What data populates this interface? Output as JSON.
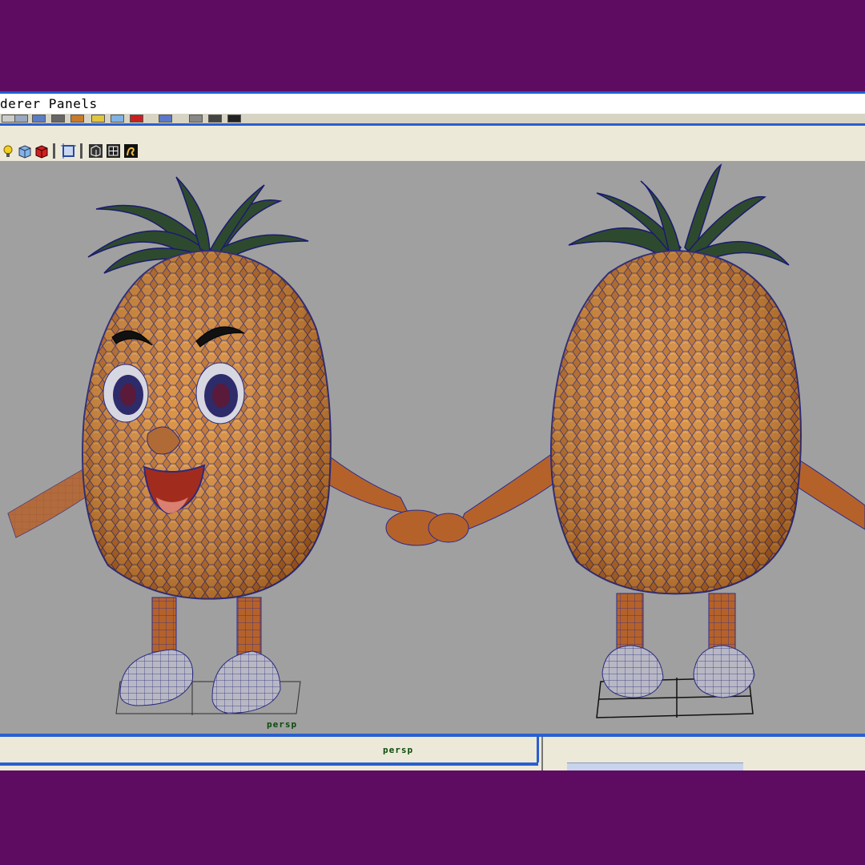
{
  "menu": {
    "visible_text": "derer Panels"
  },
  "viewport": {
    "label_left": "persp",
    "label_bottom": "persp"
  },
  "toolbar_icons": [
    "light-icon",
    "cube-icon",
    "red-cube-icon",
    "frame-icon",
    "wireframe-box-icon",
    "grid-box-icon",
    "render-icon"
  ],
  "colors": {
    "brand_purple": "#5e0b62",
    "viewport_gray": "#a0a0a0",
    "accent_blue": "#2a5fd0"
  }
}
